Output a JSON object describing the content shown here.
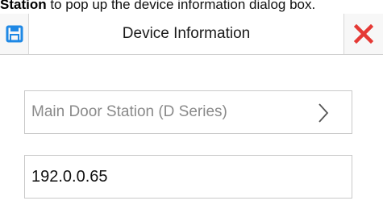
{
  "caption": {
    "bold_text": "Station",
    "rest_text": " to pop up the device information dialog box."
  },
  "dialog": {
    "title": "Device Information",
    "save_icon": "floppy-disk-icon",
    "close_icon": "close-x-icon",
    "accent_color": "#1e88e5",
    "close_color": "#e53935"
  },
  "fields": {
    "device_type": {
      "value": "Main Door Station (D Series)",
      "icon": "chevron-right-icon"
    },
    "ip_address": {
      "value": "192.0.0.65"
    }
  }
}
